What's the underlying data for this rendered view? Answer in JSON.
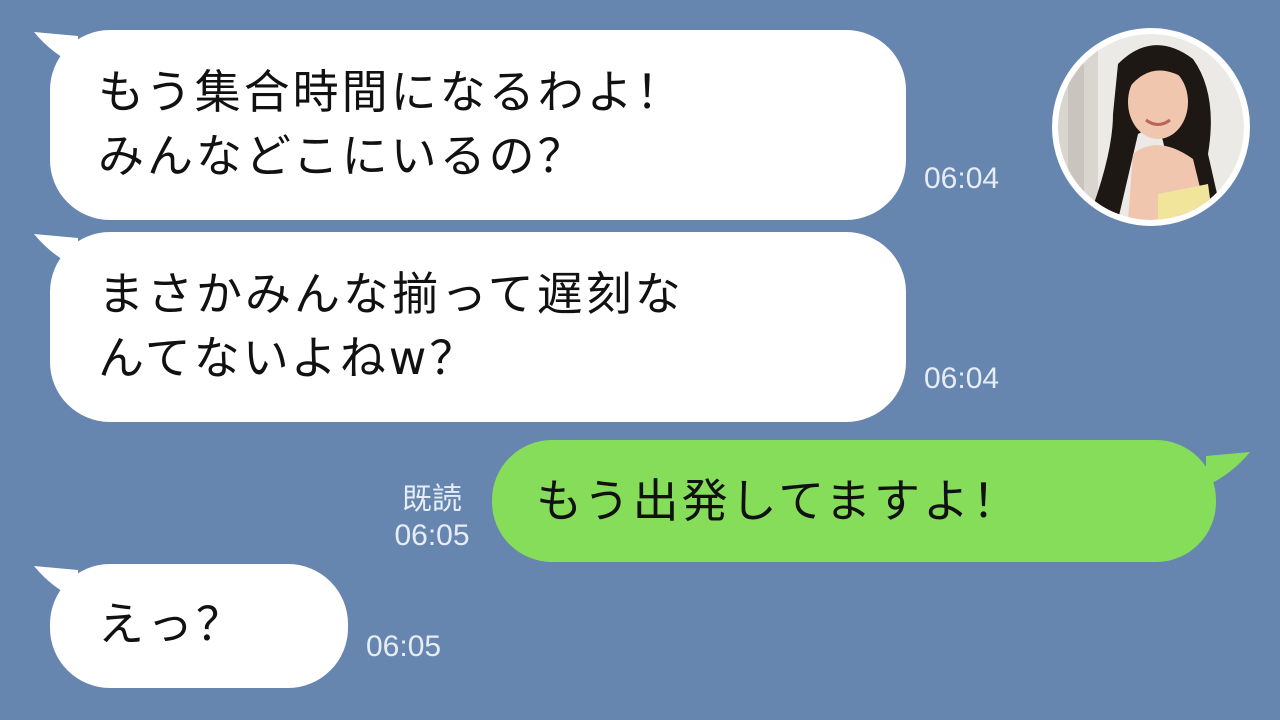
{
  "messages": [
    {
      "lines": [
        "もう集合時間になるわよ！",
        "みんなどこにいるの？"
      ],
      "time": "06:04"
    },
    {
      "lines": [
        "まさかみんな揃って遅刻な",
        "んてないよねw？"
      ],
      "time": "06:04"
    },
    {
      "lines": [
        "もう出発してますよ！"
      ],
      "read_label": "既読",
      "time": "06:05"
    },
    {
      "lines": [
        "えっ？"
      ],
      "time": "06:05"
    }
  ],
  "colors": {
    "background": "#6686b0",
    "incoming_bubble": "#ffffff",
    "outgoing_bubble": "#86dd59",
    "timestamp": "#e6edf6"
  },
  "avatar": {
    "icon": "contact-avatar-photo"
  }
}
